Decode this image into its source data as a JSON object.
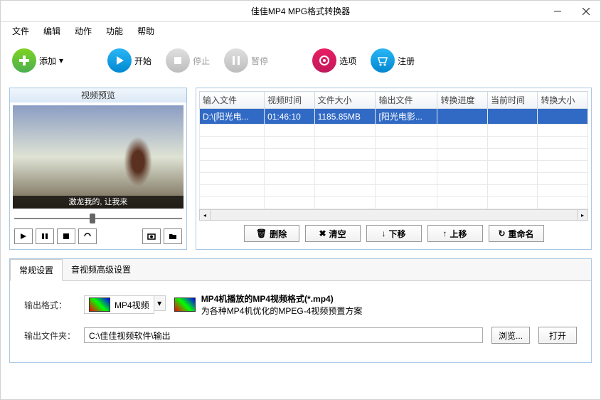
{
  "title": "佳佳MP4 MPG格式转换器",
  "menu": [
    "文件",
    "编辑",
    "动作",
    "功能",
    "帮助"
  ],
  "toolbar": {
    "add": "添加",
    "start": "开始",
    "stop": "停止",
    "pause": "暂停",
    "options": "选项",
    "register": "注册"
  },
  "preview": {
    "title": "视频预览",
    "subtitle": "激龙我的, 让我来"
  },
  "table": {
    "headers": [
      "输入文件",
      "视频时间",
      "文件大小",
      "输出文件",
      "转换进度",
      "当前时间",
      "转换大小"
    ],
    "row": {
      "input": "D:\\[阳光电...",
      "time": "01:46:10",
      "size": "1185.85MB",
      "output": "[阳光电影...",
      "progress": "",
      "curtime": "",
      "cursize": ""
    }
  },
  "actions": {
    "delete": "删除",
    "clear": "清空",
    "down": "下移",
    "up": "上移",
    "rename": "重命名"
  },
  "tabs": {
    "general": "常规设置",
    "advanced": "音视频高级设置"
  },
  "settings": {
    "format_label": "输出格式：",
    "format_value": "MP4视频",
    "format_title": "MP4机播放的MP4视频格式(*.mp4)",
    "format_desc": "为各种MP4机优化的MPEG-4视频预置方案",
    "folder_label": "输出文件夹：",
    "folder_value": "C:\\佳佳视频软件\\输出",
    "browse": "浏览...",
    "open": "打开"
  }
}
